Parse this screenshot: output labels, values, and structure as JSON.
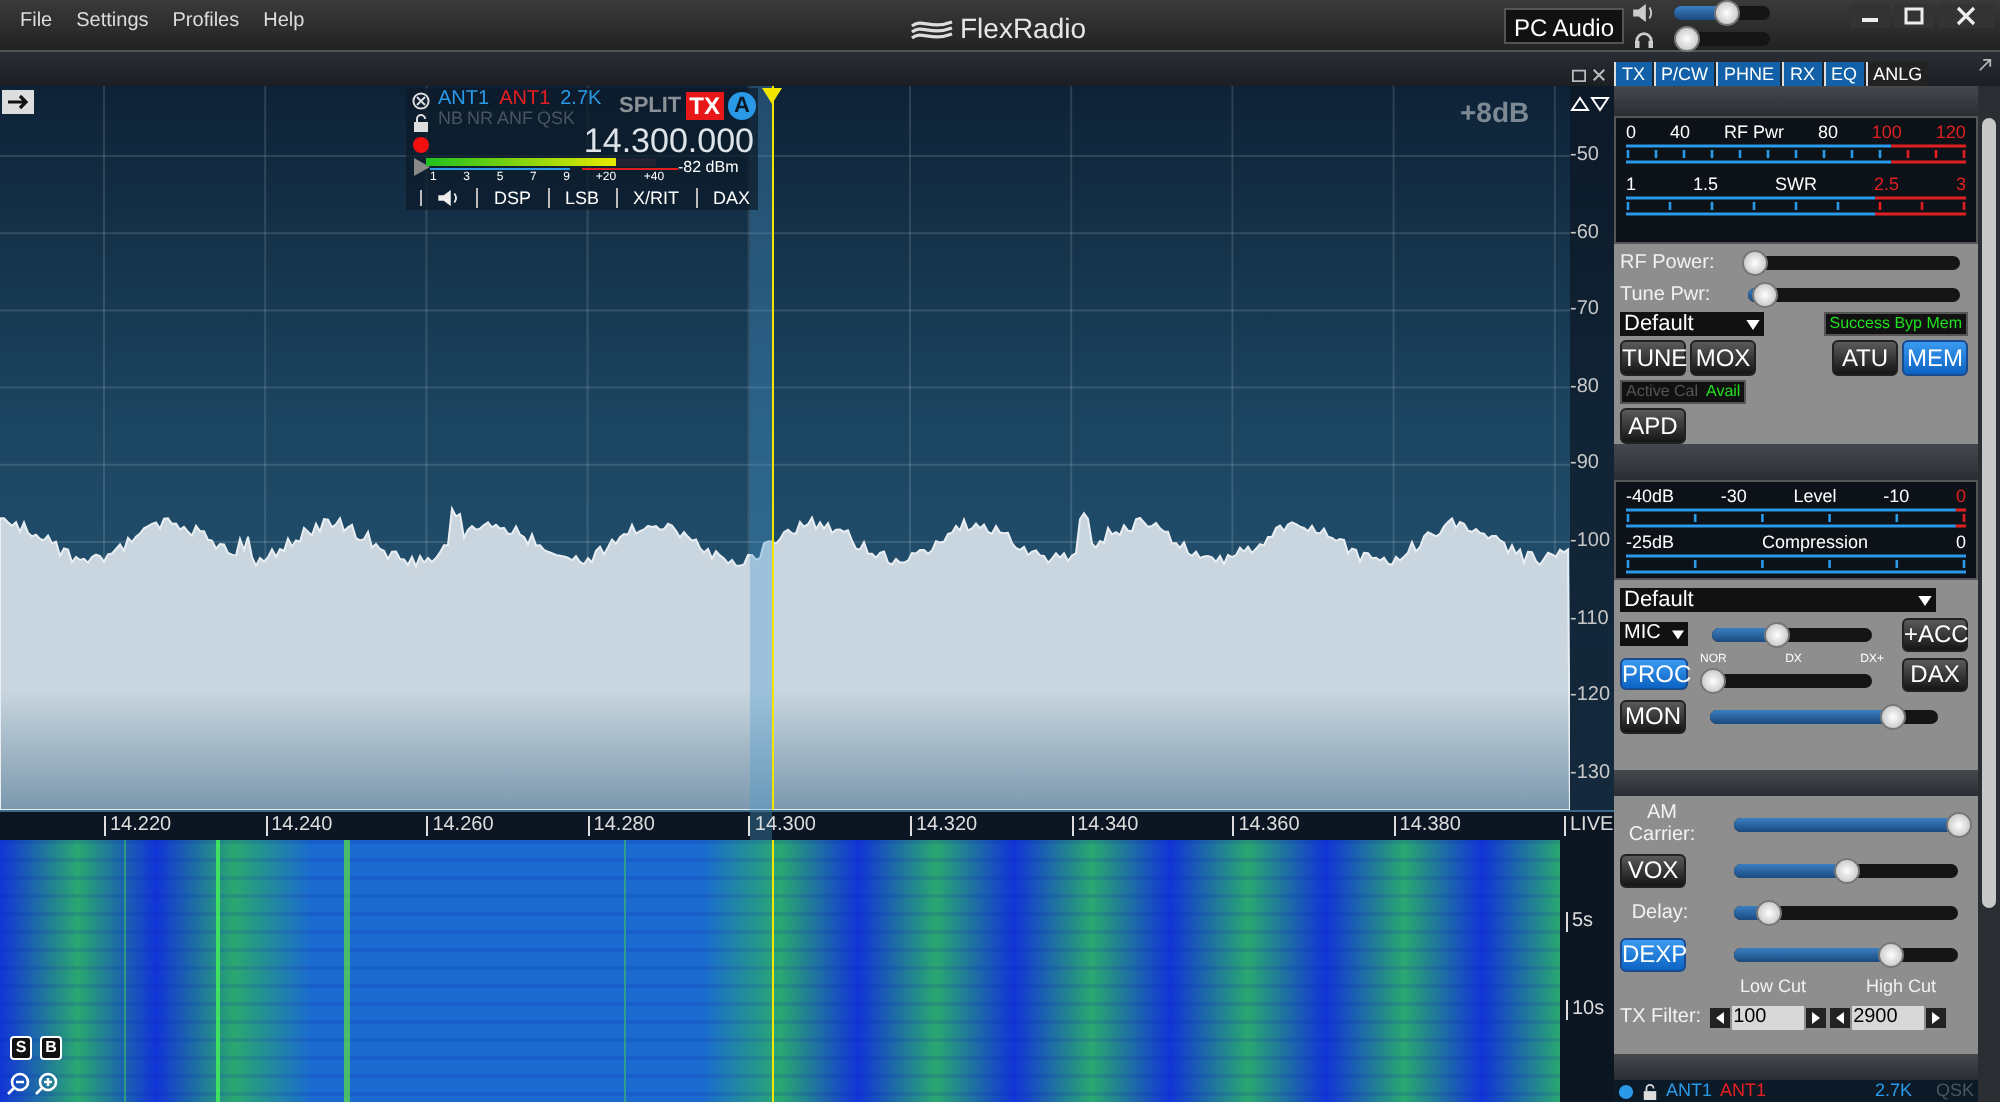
{
  "menu": [
    {
      "label": "File"
    },
    {
      "label": "Settings"
    },
    {
      "label": "Profiles"
    },
    {
      "label": "Help"
    }
  ],
  "logo": "FlexRadio",
  "audio": {
    "label": "PC Audio",
    "speaker": {
      "level": 0.55
    },
    "headphone": {
      "level": 0.12
    }
  },
  "slice": {
    "rx_antenna": "ANT1",
    "tx_antenna": "ANT1",
    "bandwidth": "2.7K",
    "dsp_flags": [
      {
        "label": "NB",
        "on": false
      },
      {
        "label": "NR",
        "on": false
      },
      {
        "label": "ANF",
        "on": false
      },
      {
        "label": "QSK",
        "on": false
      }
    ],
    "split": "SPLIT",
    "tx": "TX",
    "letter": "A",
    "frequency": "14.300.000",
    "signal_meter": {
      "level": 0.83
    },
    "signal_reading": "-82 dBm",
    "s_scale": [
      "1",
      "3",
      "5",
      "7",
      "9"
    ],
    "over_scale": [
      "+20",
      "+40"
    ],
    "tabs": [
      "DSP",
      "LSB",
      "X/RIT",
      "DAX"
    ]
  },
  "panadapter": {
    "gain": "+8dB",
    "db_labels": [
      "-50",
      "-60",
      "-70",
      "-80",
      "-90",
      "-100",
      "-110",
      "-120",
      "-130"
    ],
    "freq_labels": [
      "14.220",
      "14.240",
      "14.260",
      "14.280",
      "14.300",
      "14.320",
      "14.340",
      "14.360",
      "14.380"
    ],
    "live": "LIVE",
    "time_labels": [
      "5s",
      "10s"
    ],
    "scale_buttons": [
      "S",
      "B"
    ]
  },
  "panel_tabs": [
    {
      "label": "TX",
      "on": true
    },
    {
      "label": "P/CW",
      "on": true
    },
    {
      "label": "PHNE",
      "on": true
    },
    {
      "label": "RX",
      "on": true
    },
    {
      "label": "EQ",
      "on": true
    },
    {
      "label": "ANLG",
      "on": false
    }
  ],
  "tx_meters": [
    {
      "labels": [
        {
          "text": "0",
          "kind": "tick"
        },
        {
          "text": "40",
          "kind": "tick"
        },
        {
          "text": "RF Pwr",
          "kind": "title"
        },
        {
          "text": "80",
          "kind": "tick"
        },
        {
          "text": "100",
          "kind": "danger"
        },
        {
          "text": "120",
          "kind": "danger"
        }
      ]
    },
    {
      "labels": [
        {
          "text": "1",
          "kind": "tick"
        },
        {
          "text": "1.5",
          "kind": "tick"
        },
        {
          "text": "SWR",
          "kind": "title"
        },
        {
          "text": "2.5",
          "kind": "danger"
        },
        {
          "text": "3",
          "kind": "danger"
        }
      ]
    }
  ],
  "tx": {
    "sliders": [
      {
        "label": "RF Power:",
        "level": 0.03
      },
      {
        "label": "Tune Pwr:",
        "level": 0.08
      }
    ],
    "profile": "Default",
    "atu_status": "Success Byp Mem",
    "buttons": [
      {
        "label": "TUNE",
        "on": false
      },
      {
        "label": "MOX",
        "on": false
      }
    ],
    "atu_buttons": [
      {
        "label": "ATU",
        "on": false
      },
      {
        "label": "MEM",
        "on": true
      }
    ],
    "cal_label": "Active Cal",
    "cal_status": "Avail",
    "apd": {
      "label": "APD",
      "on": false
    }
  },
  "mic_meters": [
    {
      "labels": [
        {
          "text": "-40dB",
          "kind": "tick"
        },
        {
          "text": "-30",
          "kind": "tick"
        },
        {
          "text": "Level",
          "kind": "title"
        },
        {
          "text": "-10",
          "kind": "tick"
        },
        {
          "text": "0",
          "kind": "danger"
        }
      ]
    },
    {
      "labels": [
        {
          "text": "-25dB",
          "kind": "tick"
        },
        {
          "text": "Compression",
          "kind": "title"
        },
        {
          "text": "0",
          "kind": "tick"
        }
      ]
    }
  ],
  "mic": {
    "profile": "Default",
    "source": "MIC",
    "mic_slider": {
      "level": 0.4
    },
    "acc": {
      "label": "+ACC",
      "on": false
    },
    "proc": {
      "label": "PROC",
      "on": true
    },
    "proc_marks": [
      "NOR",
      "DX",
      "DX+"
    ],
    "proc_slider": {
      "level": 0.0
    },
    "dax": {
      "label": "DAX",
      "on": false
    },
    "mon": {
      "label": "MON",
      "on": false
    },
    "mon_slider": {
      "level": 0.8
    }
  },
  "audio_controls": {
    "am_carrier": {
      "label": "AM Carrier:",
      "level": 1.0
    },
    "vox": {
      "label": "VOX",
      "on": false
    },
    "vox_slider": {
      "level": 0.5
    },
    "delay": {
      "label": "Delay:",
      "level": 0.15
    },
    "dexp": {
      "label": "DEXP",
      "on": true
    },
    "dexp_slider": {
      "level": 0.7
    },
    "low_cut_label": "Low Cut",
    "high_cut_label": "High Cut",
    "filter_label": "TX Filter:",
    "low_cut": "100",
    "high_cut": "2900"
  },
  "slice_b": {
    "rx_antenna": "ANT1",
    "tx_antenna": "ANT1",
    "bandwidth": "2.7K",
    "flag": "QSK"
  }
}
